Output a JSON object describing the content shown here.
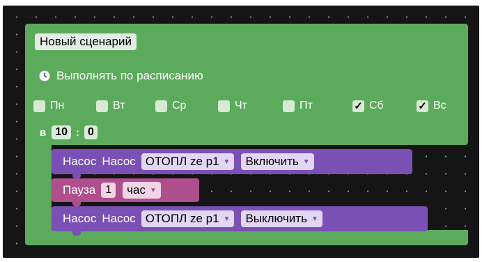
{
  "scenario": {
    "title": "Новый сценарий",
    "schedule_label": "Выполнять по расписанию",
    "days": [
      {
        "label": "Пн",
        "checked": false,
        "mark": ""
      },
      {
        "label": "Вт",
        "checked": false,
        "mark": ""
      },
      {
        "label": "Ср",
        "checked": false,
        "mark": ""
      },
      {
        "label": "Чт",
        "checked": false,
        "mark": ""
      },
      {
        "label": "Пт",
        "checked": false,
        "mark": ""
      },
      {
        "label": "Сб",
        "checked": true,
        "mark": "✓"
      },
      {
        "label": "Вс",
        "checked": true,
        "mark": "✓"
      }
    ],
    "time_prefix": "в",
    "hour": "10",
    "time_separator": ":",
    "minute": "0"
  },
  "blocks": [
    {
      "type": "pump",
      "label1": "Насос",
      "label2": "Насос",
      "device": "ОТОПЛ ze p1",
      "action": "Включить"
    },
    {
      "type": "pause",
      "label": "Пауза",
      "value": "1",
      "unit": "час"
    },
    {
      "type": "pump",
      "label1": "Насос",
      "label2": "Насос",
      "device": "ОТОПЛ ze p1",
      "action": "Выключить"
    }
  ],
  "dropdown_arrow": "▼",
  "colors": {
    "workspace": "#151515",
    "scenario_block": "#5cab5c",
    "pump_block": "#7a50b4",
    "pause_block": "#b04f8e"
  }
}
